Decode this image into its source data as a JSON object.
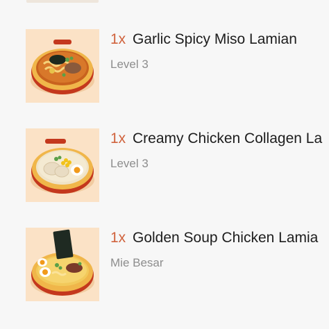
{
  "order": {
    "items": [
      {
        "quantity": "1x",
        "name": "Garlic Spicy Miso Lamian",
        "option": "Level 3",
        "image_icon": "ramen-bowl-image"
      },
      {
        "quantity": "1x",
        "name": "Creamy Chicken Collagen La",
        "option": "Level 3",
        "image_icon": "ramen-bowl-image"
      },
      {
        "quantity": "1x",
        "name": "Golden Soup Chicken Lamia",
        "option": "Mie Besar",
        "image_icon": "ramen-bowl-image"
      }
    ]
  },
  "colors": {
    "background": "#f7f7f7",
    "quantity_accent": "#d0623c",
    "name_text": "#1d1d1d",
    "option_text": "#8d8d8d",
    "thumbnail_bg": "#fbe2c6"
  }
}
